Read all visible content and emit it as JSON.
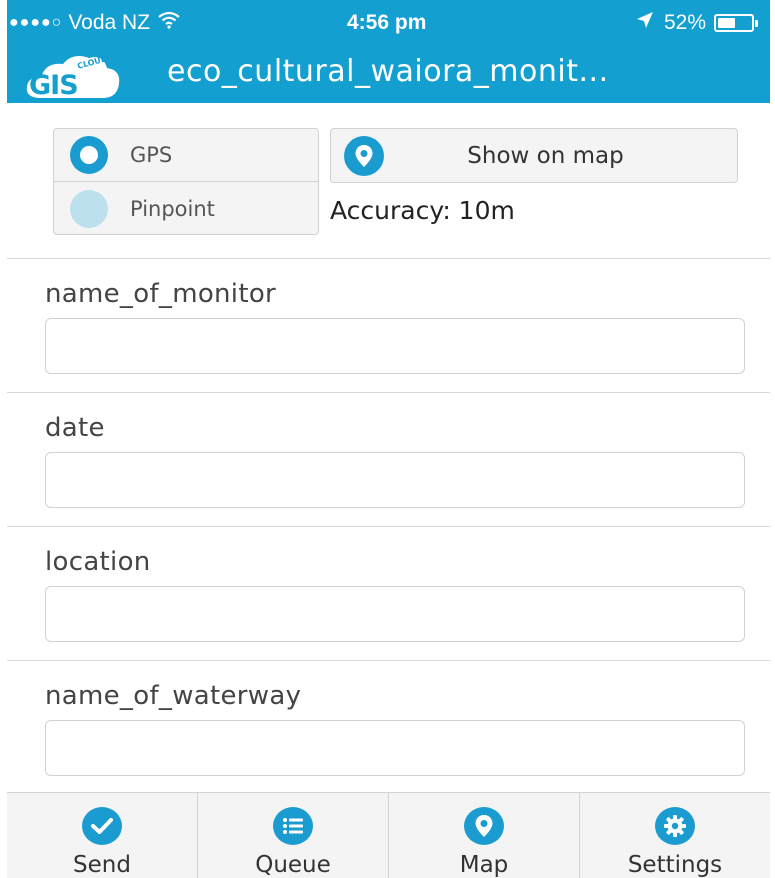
{
  "status_bar": {
    "signal": "●●●●○",
    "carrier": "Voda NZ",
    "wifi": "ᯤ",
    "time": "4:56 pm",
    "location_arrow": "➚",
    "battery": "52%",
    "battery_level": 0.52
  },
  "header": {
    "logo_small_text": "CLOUD",
    "logo_text": "GIS",
    "title": "eco_cultural_waiora_monit..."
  },
  "location": {
    "options": [
      {
        "label": "GPS",
        "selected": true
      },
      {
        "label": "Pinpoint",
        "selected": false
      }
    ],
    "show_on_map_label": "Show on map",
    "accuracy": "Accuracy: 10m"
  },
  "form": {
    "fields": [
      {
        "label": "name_of_monitor",
        "value": ""
      },
      {
        "label": "date",
        "value": ""
      },
      {
        "label": "location",
        "value": ""
      },
      {
        "label": "name_of_waterway",
        "value": ""
      }
    ]
  },
  "tabbar": {
    "tabs": [
      {
        "label": "Send",
        "icon": "check-icon"
      },
      {
        "label": "Queue",
        "icon": "list-icon"
      },
      {
        "label": "Map",
        "icon": "map-pin-icon"
      },
      {
        "label": "Settings",
        "icon": "gear-icon"
      }
    ]
  },
  "colors": {
    "brand": "#139fcf",
    "accent": "#1a9cd0",
    "accent_light": "#bde0ee"
  }
}
